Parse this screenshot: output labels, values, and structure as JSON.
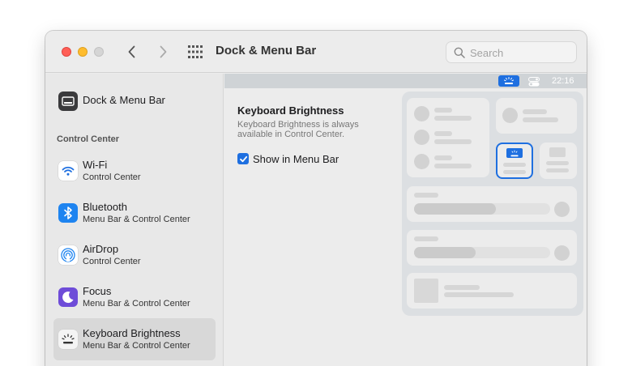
{
  "window": {
    "title": "Dock & Menu Bar",
    "search_placeholder": "Search"
  },
  "sidebar": {
    "top_item": {
      "label": "Dock & Menu Bar"
    },
    "section_header": "Control Center",
    "items": [
      {
        "label": "Wi-Fi",
        "sub": "Control Center",
        "icon": "wifi-icon"
      },
      {
        "label": "Bluetooth",
        "sub": "Menu Bar & Control Center",
        "icon": "bluetooth-icon"
      },
      {
        "label": "AirDrop",
        "sub": "Control Center",
        "icon": "airdrop-icon"
      },
      {
        "label": "Focus",
        "sub": "Menu Bar & Control Center",
        "icon": "moon-icon"
      },
      {
        "label": "Keyboard Brightness",
        "sub": "Menu Bar & Control Center",
        "icon": "keyboard-brightness-icon",
        "selected": true
      }
    ]
  },
  "menubar_preview": {
    "time": "22:16"
  },
  "detail": {
    "title": "Keyboard Brightness",
    "description": "Keyboard Brightness is always available in Control Center.",
    "checkbox_label": "Show in Menu Bar",
    "checkbox_checked": true
  },
  "preview_sliders": [
    0.6,
    0.45
  ],
  "colors": {
    "accent": "#1e6fe0",
    "close": "#ff5f57",
    "minimize": "#febc2e",
    "zoom_disabled": "#d5d5d5"
  }
}
